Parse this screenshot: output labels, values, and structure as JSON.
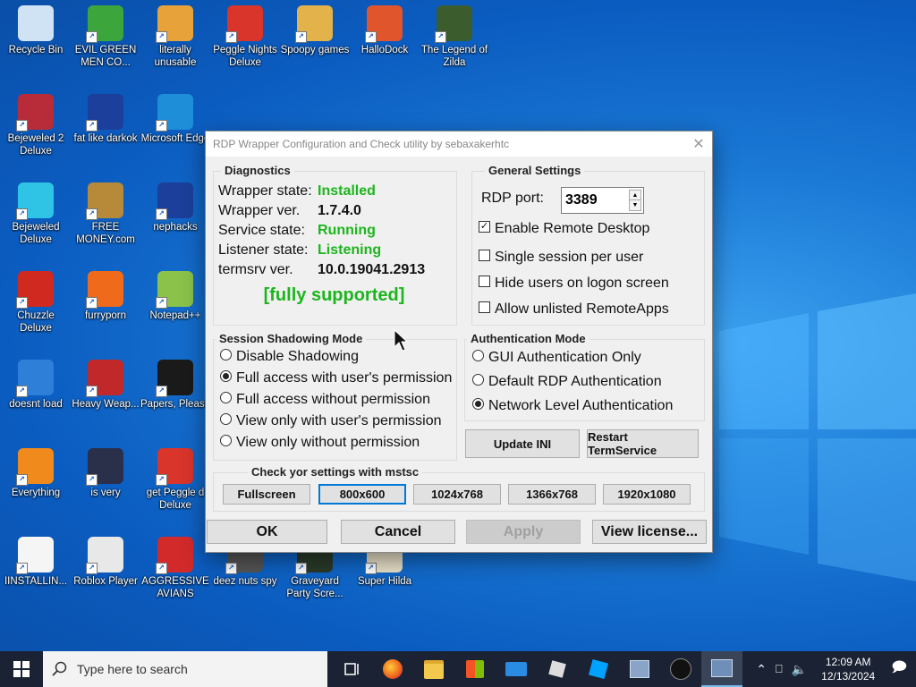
{
  "desktop": {
    "icons": [
      {
        "label": "Recycle Bin",
        "icon": "recycle-bin-icon",
        "color": "#cfe3f5"
      },
      {
        "label": "EVIL GREEN MEN CO...",
        "icon": "green-men-icon",
        "color": "#3ca63c"
      },
      {
        "label": "literally unusable",
        "icon": "chrome-icon",
        "color": "#e8a23a"
      },
      {
        "label": "Peggle Nights Deluxe",
        "icon": "peggle-icon",
        "color": "#d9352b"
      },
      {
        "label": "Spoopy games",
        "icon": "folder-icon",
        "color": "#e3b24a"
      },
      {
        "label": "HalloDock",
        "icon": "shield-icon",
        "color": "#e0552b"
      },
      {
        "label": "The Legend of Zilda",
        "icon": "zelda-icon",
        "color": "#3b5d2e"
      },
      {
        "label": "Bejeweled 2 Deluxe",
        "icon": "bejeweled2-icon",
        "color": "#b82c3a"
      },
      {
        "label": "fat like darkok",
        "icon": "mpi-icon",
        "color": "#1c3f9c"
      },
      {
        "label": "Microsoft Edge",
        "icon": "edge-icon",
        "color": "#1f8ed8"
      },
      {
        "label": "Bejeweled Deluxe",
        "icon": "gem-icon",
        "color": "#2fc4e6"
      },
      {
        "label": "FREE MONEY.com",
        "icon": "money-bag-icon",
        "color": "#b78a3a"
      },
      {
        "label": "nephacks",
        "icon": "mpi-icon",
        "color": "#1c3f9c"
      },
      {
        "label": "Chuzzle Deluxe",
        "icon": "chuzzle-icon",
        "color": "#d02a20"
      },
      {
        "label": "furryporn",
        "icon": "firefox-icon",
        "color": "#f06a1c"
      },
      {
        "label": "Notepad++",
        "icon": "notepad-icon",
        "color": "#8bc34a"
      },
      {
        "label": "doesnt load",
        "icon": "thunderbird-icon",
        "color": "#2d7fd8"
      },
      {
        "label": "Heavy Weap...",
        "icon": "radiation-icon",
        "color": "#c0282a"
      },
      {
        "label": "Papers, Please",
        "icon": "papers-icon",
        "color": "#1a1a1a"
      },
      {
        "label": "Everything",
        "icon": "magnifier-icon",
        "color": "#f08a1c"
      },
      {
        "label": "is very",
        "icon": "mpi-icon",
        "color": "#2a2f4a"
      },
      {
        "label": "get Peggle d Deluxe",
        "icon": "peggle-icon",
        "color": "#d9352b"
      },
      {
        "label": "IINSTALLIN...",
        "icon": "text-file-icon",
        "color": "#f5f5f5"
      },
      {
        "label": "Roblox Player",
        "icon": "roblox-icon",
        "color": "#e8e8e8"
      },
      {
        "label": "AGGRESSIVE AVIANS",
        "icon": "angry-bird-icon",
        "color": "#d22a2a"
      },
      {
        "label": "deez nuts spy",
        "icon": "spy-icon",
        "color": "#555555"
      },
      {
        "label": "Graveyard Party Scre...",
        "icon": "graveyard-icon",
        "color": "#2a3a2a"
      },
      {
        "label": "Super Hilda",
        "icon": "hilda-icon",
        "color": "#e8e0c8"
      }
    ]
  },
  "dialog": {
    "title": "RDP Wrapper Configuration and Check utility by sebaxakerhtc",
    "close": "✕",
    "diagnostics": {
      "title": "Diagnostics",
      "wrapper_state_label": "Wrapper state:",
      "wrapper_state_value": "Installed",
      "wrapper_ver_label": "Wrapper ver.",
      "wrapper_ver_value": "1.7.4.0",
      "service_state_label": "Service state:",
      "service_state_value": "Running",
      "listener_state_label": "Listener state:",
      "listener_state_value": "Listening",
      "termsrv_label": "termsrv ver.",
      "termsrv_value": "10.0.19041.2913",
      "support": "[fully supported]",
      "ok_color": "#1db51d"
    },
    "general": {
      "title": "General Settings",
      "port_label": "RDP port:",
      "port_value": "3389",
      "enable_rdp": "Enable Remote Desktop",
      "enable_rdp_checked": true,
      "single_session": "Single session per user",
      "hide_users": "Hide users on logon screen",
      "allow_unlisted": "Allow unlisted RemoteApps"
    },
    "shadowing": {
      "title": "Session Shadowing Mode",
      "options": [
        "Disable Shadowing",
        "Full access with user's permission",
        "Full access without permission",
        "View only with user's permission",
        "View only without permission"
      ],
      "selected": 1
    },
    "auth": {
      "title": "Authentication Mode",
      "options": [
        "GUI Authentication Only",
        "Default RDP Authentication",
        "Network Level Authentication"
      ],
      "selected": 2
    },
    "update_ini": "Update INI",
    "restart_termservice": "Restart TermService",
    "mstsc": {
      "title": "Check yor settings with mstsc",
      "buttons": [
        "Fullscreen",
        "800x600",
        "1024x768",
        "1366x768",
        "1920x1080"
      ],
      "selected": 1
    },
    "ok": "OK",
    "cancel": "Cancel",
    "apply": "Apply",
    "view_license": "View license..."
  },
  "taskbar": {
    "search_placeholder": "Type here to search",
    "time": "12:09 AM",
    "date": "12/13/2024",
    "bg": "#1a2233"
  }
}
